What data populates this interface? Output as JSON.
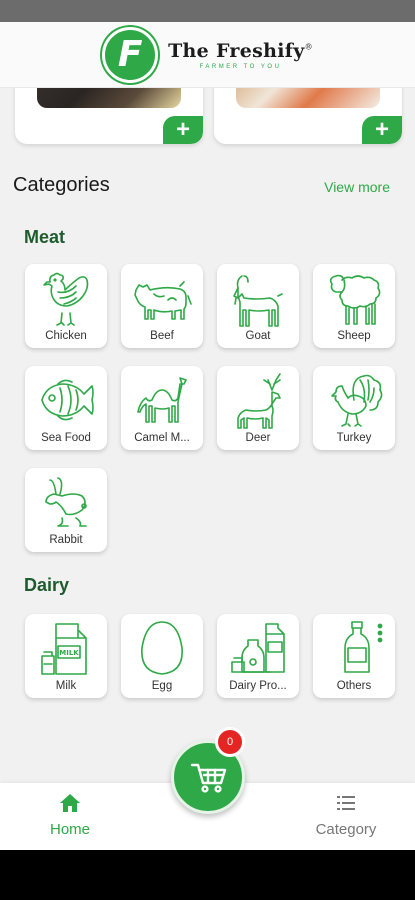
{
  "header": {
    "brand_name": "The Freshify",
    "registered": "®",
    "tagline": "FARMER TO YOU",
    "logo_letter": "F"
  },
  "categories": {
    "title": "Categories",
    "view_more": "View more"
  },
  "sections": {
    "meat": {
      "title": "Meat",
      "items": [
        {
          "label": "Chicken",
          "icon": "chicken-icon"
        },
        {
          "label": "Beef",
          "icon": "cow-icon"
        },
        {
          "label": "Goat",
          "icon": "goat-icon"
        },
        {
          "label": "Sheep",
          "icon": "sheep-icon"
        },
        {
          "label": "Sea Food",
          "icon": "fish-icon"
        },
        {
          "label": "Camel M...",
          "icon": "camel-icon"
        },
        {
          "label": "Deer",
          "icon": "deer-icon"
        },
        {
          "label": "Turkey",
          "icon": "turkey-icon"
        },
        {
          "label": "Rabbit",
          "icon": "rabbit-icon"
        }
      ]
    },
    "dairy": {
      "title": "Dairy",
      "items": [
        {
          "label": "Milk",
          "icon": "milk-carton-icon",
          "carton_text": "MILK"
        },
        {
          "label": "Egg",
          "icon": "egg-icon"
        },
        {
          "label": "Dairy Pro...",
          "icon": "dairy-products-icon"
        },
        {
          "label": "Others",
          "icon": "bottle-icon"
        }
      ]
    }
  },
  "cart": {
    "count": "0"
  },
  "bottom_nav": {
    "home": "Home",
    "category": "Category"
  },
  "colors": {
    "accent": "#2fa847",
    "section_title": "#1e5b2e",
    "badge": "#e52424"
  }
}
